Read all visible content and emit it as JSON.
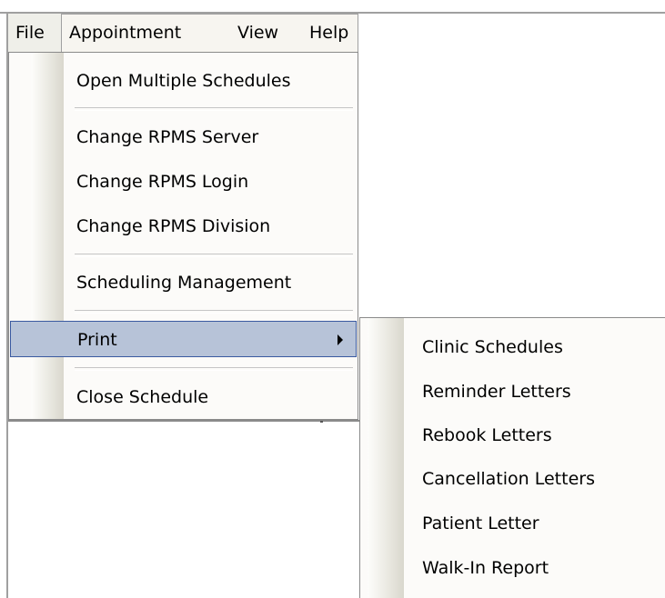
{
  "menubar": {
    "items": [
      {
        "label": "File"
      },
      {
        "label": "Appointment"
      },
      {
        "label": "View"
      },
      {
        "label": "Help"
      }
    ]
  },
  "file_menu": {
    "items": [
      {
        "label": "Open Multiple Schedules"
      },
      {
        "label": "Change RPMS Server"
      },
      {
        "label": "Change RPMS Login"
      },
      {
        "label": "Change RPMS Division"
      },
      {
        "label": "Scheduling Management"
      },
      {
        "label": "Print"
      },
      {
        "label": "Close Schedule"
      }
    ]
  },
  "print_submenu": {
    "items": [
      {
        "label": "Clinic Schedules"
      },
      {
        "label": "Reminder Letters"
      },
      {
        "label": "Rebook Letters"
      },
      {
        "label": "Cancellation Letters"
      },
      {
        "label": "Patient Letter"
      },
      {
        "label": "Walk-In Report"
      }
    ]
  },
  "colors": {
    "highlight_bg": "#b7c3d8",
    "highlight_border": "#3b5aa0",
    "menu_bg": "#fcfbf9",
    "menubar_bg": "#efefe9"
  },
  "icons": {
    "submenu_arrow": "triangle-right"
  }
}
